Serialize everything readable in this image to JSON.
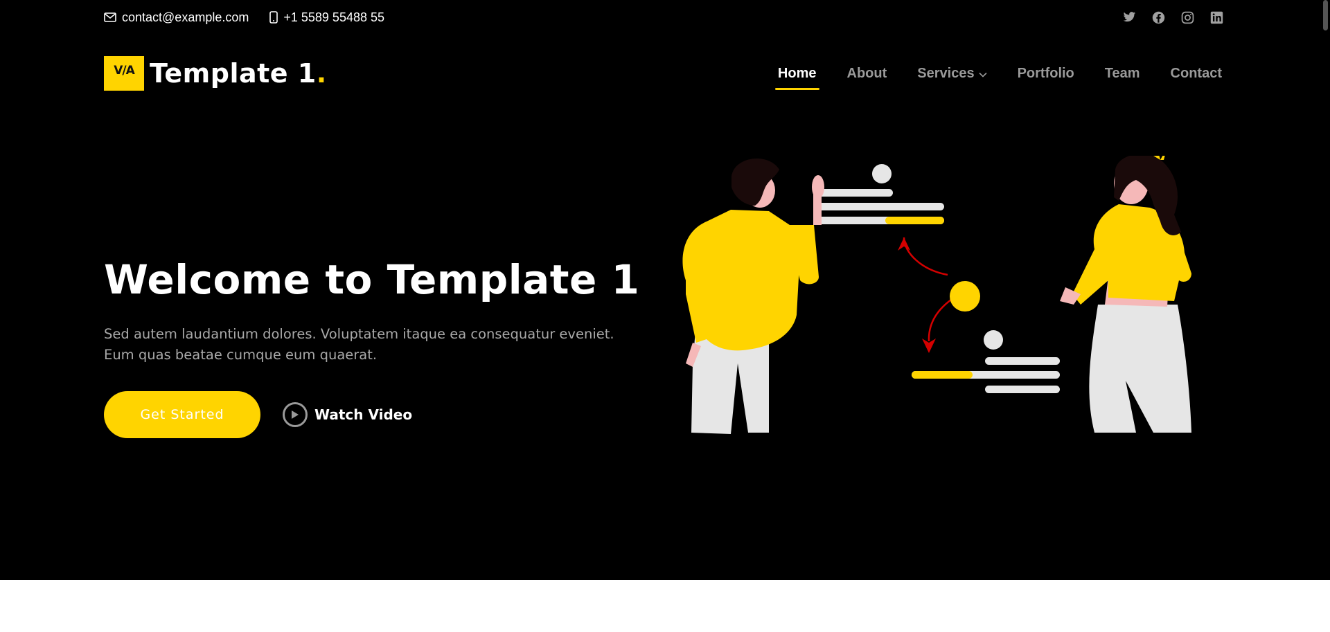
{
  "topbar": {
    "email": "contact@example.com",
    "phone": "+1 5589 55488 55",
    "socials": [
      "twitter-icon",
      "facebook-icon",
      "instagram-icon",
      "linkedin-icon"
    ]
  },
  "brand": {
    "logo_mark": "V/A",
    "name": "Template 1",
    "dot": "."
  },
  "nav": {
    "items": [
      {
        "label": "Home",
        "active": true
      },
      {
        "label": "About"
      },
      {
        "label": "Services",
        "has_dropdown": true
      },
      {
        "label": "Portfolio"
      },
      {
        "label": "Team"
      },
      {
        "label": "Contact"
      }
    ]
  },
  "hero": {
    "title": "Welcome to Template 1",
    "subtitle": "Sed autem laudantium dolores. Voluptatem itaque ea consequatur eveniet. Eum quas beatae cumque eum quaerat.",
    "cta_label": "Get Started",
    "video_label": "Watch Video"
  },
  "colors": {
    "accent": "#ffd400",
    "background": "#000000",
    "text": "#ffffff",
    "muted": "#a8a8a8",
    "arrow": "#d40000"
  }
}
